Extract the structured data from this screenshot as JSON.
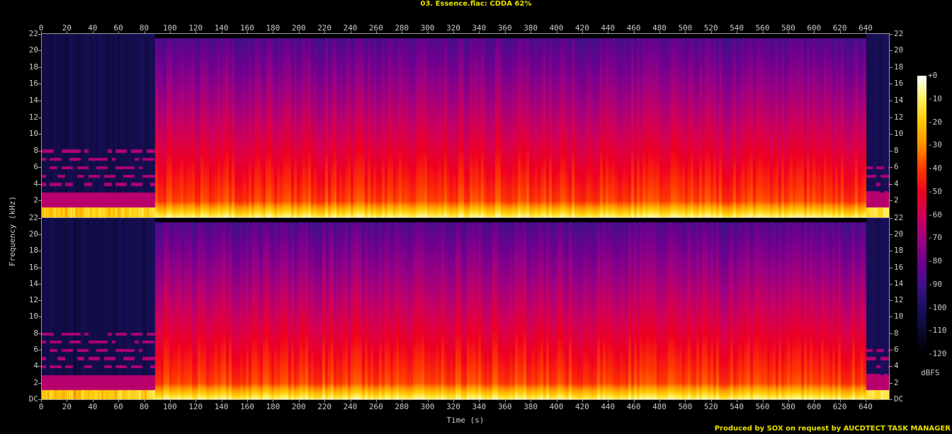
{
  "title": "03. Essence.flac: CDDA 62%",
  "footer": "Produced by SOX on request by AUCDTECT TASK MANAGER",
  "chart_data": {
    "type": "heatmap",
    "subtype": "spectrogram",
    "channels": 2,
    "xlabel": "Time (s)",
    "ylabel": "Frequency (kHz)",
    "xlim": [
      0,
      658
    ],
    "x_ticks": [
      "0",
      "20",
      "40",
      "60",
      "80",
      "100",
      "120",
      "140",
      "160",
      "180",
      "200",
      "220",
      "240",
      "260",
      "280",
      "300",
      "320",
      "340",
      "360",
      "380",
      "400",
      "420",
      "440",
      "460",
      "480",
      "500",
      "520",
      "540",
      "560",
      "580",
      "600",
      "620",
      "640"
    ],
    "ylim": [
      0,
      22.05
    ],
    "y_ticks_top": [
      "22",
      "20",
      "18",
      "16",
      "14",
      "12",
      "10",
      "8",
      "6",
      "4",
      "2"
    ],
    "y_ticks_bottom": [
      "22",
      "20",
      "18",
      "16",
      "14",
      "12",
      "10",
      "8",
      "6",
      "4",
      "2",
      "DC"
    ],
    "colorbar": {
      "label": "dBFS",
      "range": [
        -120,
        0
      ],
      "ticks": [
        "+0",
        "-10",
        "-20",
        "-30",
        "-40",
        "-50",
        "-60",
        "-70",
        "-80",
        "-90",
        "-100",
        "-110",
        "-120"
      ]
    },
    "segments": [
      {
        "start": 0,
        "end": 88,
        "character": "quiet tonal",
        "hf_level_dbfs": -105,
        "tone_lines_khz": [
          4,
          5,
          6,
          7,
          8
        ]
      },
      {
        "start": 88,
        "end": 640,
        "character": "broadband",
        "hf_level_dbfs": -85,
        "bandwidth_khz": 21.5
      },
      {
        "start": 640,
        "end": 658,
        "character": "quiet tonal",
        "hf_level_dbfs": -110,
        "tone_lines_khz": [
          3,
          4,
          5,
          6
        ]
      }
    ]
  },
  "colors": {
    "text": "#c8c8c8",
    "title": "#e8e000",
    "colormap": [
      "#000000",
      "#0a0a30",
      "#1a1060",
      "#40108a",
      "#700090",
      "#a00080",
      "#d0005a",
      "#f00020",
      "#ff3c00",
      "#ff9000",
      "#ffc800",
      "#fff060",
      "#ffffff"
    ]
  }
}
